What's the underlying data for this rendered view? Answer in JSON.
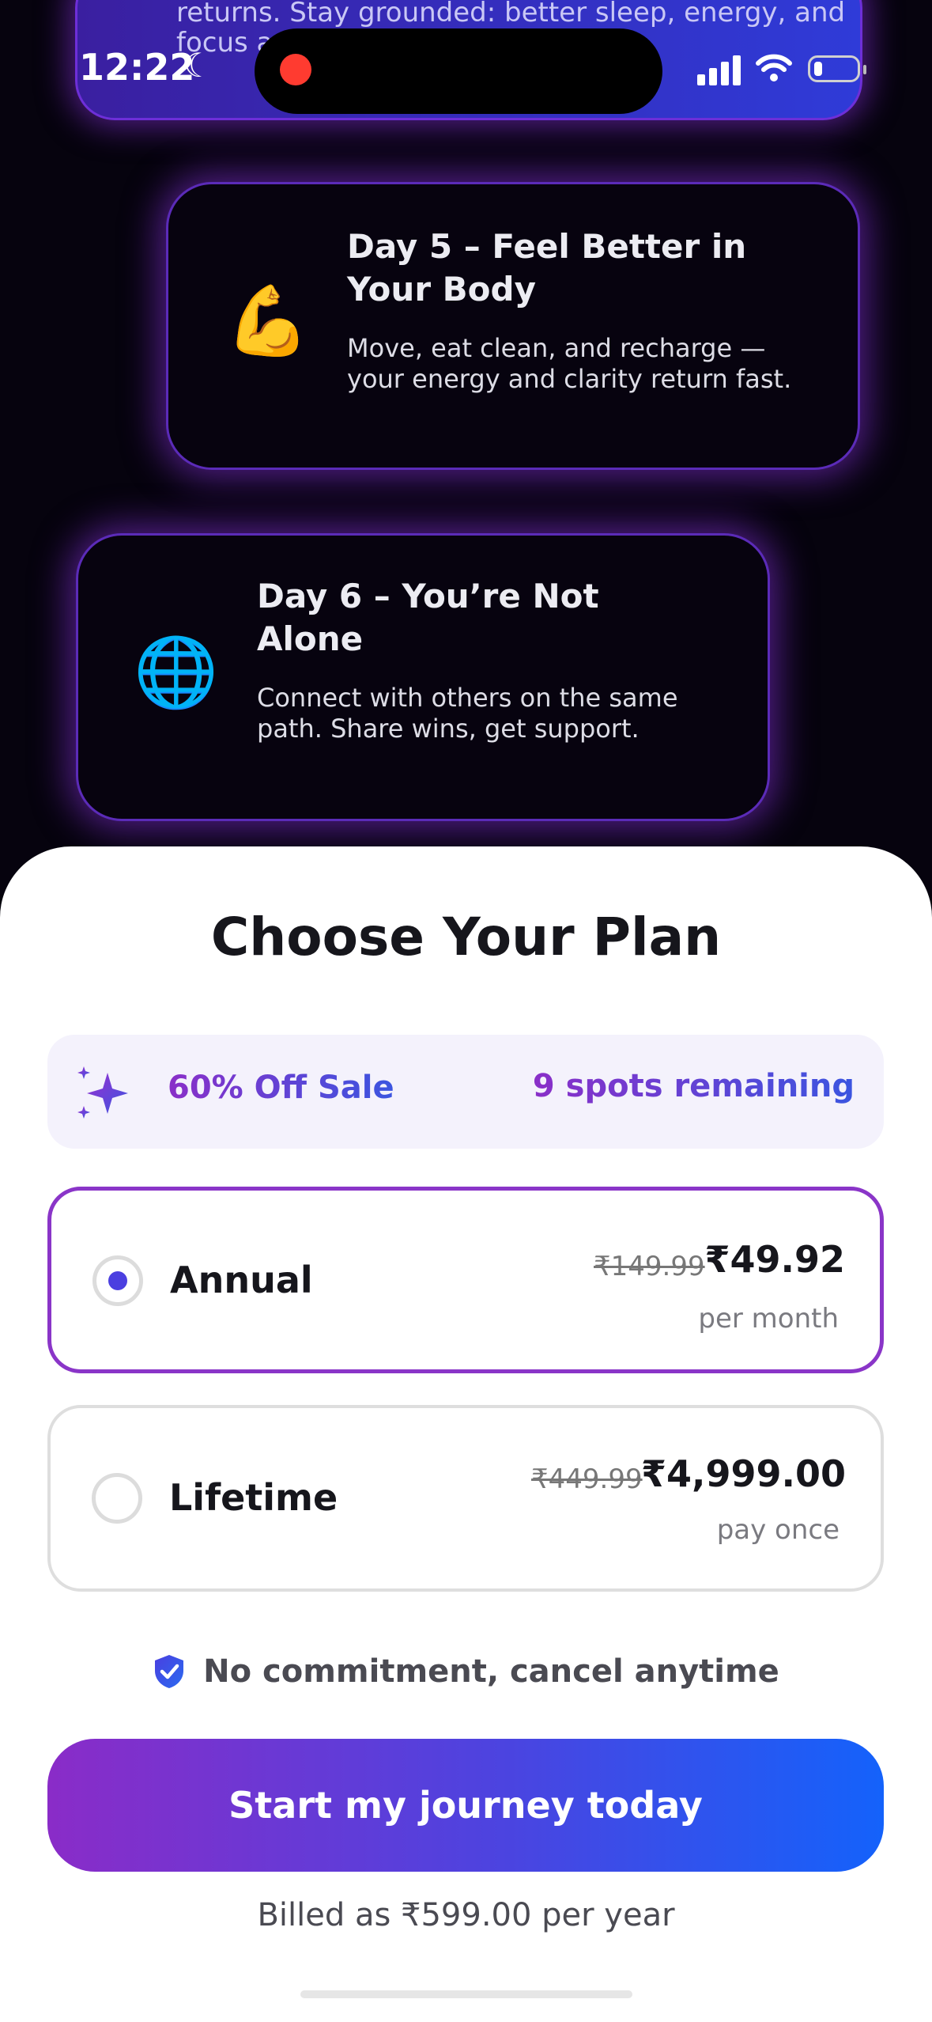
{
  "status_bar": {
    "time": "12:22",
    "moon_icon": "moon-icon",
    "wifi_icon": "wifi-icon",
    "battery_icon": "battery-icon"
  },
  "timeline": {
    "partial_card": {
      "text": "The fog begins to lift, and motivation slowly returns. Stay grounded: better sleep, energy, and focus are just around the corner."
    },
    "cards": [
      {
        "emoji": "💪",
        "icon": "flexed-biceps-icon",
        "title": "Day 5 – Feel Better in Your Body",
        "text": "Move, eat clean, and recharge — your energy and clarity return fast."
      },
      {
        "emoji": "🌐",
        "icon": "globe-icon",
        "title": "Day 6 – You’re Not Alone",
        "text": "Connect with others on the same path. Share wins, get support."
      }
    ]
  },
  "paywall": {
    "title": "Choose Your Plan",
    "sale": {
      "icon": "sparkle-icon",
      "label": "60% Off Sale",
      "spots": "9 spots remaining"
    },
    "plans": [
      {
        "name": "Annual",
        "old_price": "₹149.99",
        "price": "₹49.92",
        "sub": "per month",
        "selected": true
      },
      {
        "name": "Lifetime",
        "old_price": "₹449.99",
        "price": "₹4,999.00",
        "sub": "pay once",
        "selected": false
      }
    ],
    "commitment": {
      "icon": "shield-check-icon",
      "text": "No commitment, cancel anytime"
    },
    "cta_label": "Start my journey today",
    "billed_note": "Billed as ₹599.00 per year"
  },
  "colors": {
    "accent_purple": "#8a35c8",
    "accent_blue": "#1462fb",
    "radio_dot": "#4b3fe0"
  }
}
